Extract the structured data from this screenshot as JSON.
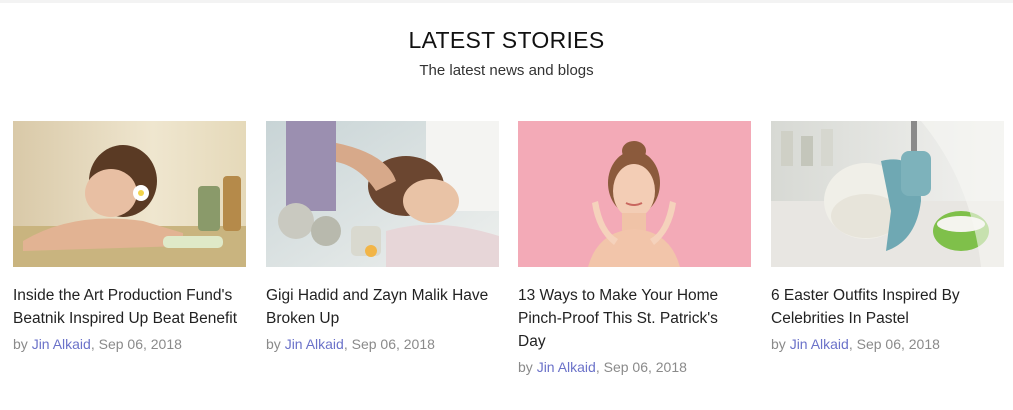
{
  "section": {
    "title": "LATEST STORIES",
    "subtitle": "The latest news and blogs"
  },
  "stories": [
    {
      "title": "Inside the Art Production Fund's Beatnik Inspired Up Beat Benefit",
      "by": "by",
      "author": "Jin Alkaid",
      "date": ", Sep 06, 2018"
    },
    {
      "title": "Gigi Hadid and Zayn Malik Have Broken Up",
      "by": "by",
      "author": "Jin Alkaid",
      "date": ", Sep 06, 2018"
    },
    {
      "title": "13 Ways to Make Your Home Pinch-Proof This St. Patrick's Day",
      "by": "by",
      "author": "Jin Alkaid",
      "date": ", Sep 06, 2018"
    },
    {
      "title": "6 Easter Outfits Inspired By Celebrities In Pastel",
      "by": "by",
      "author": "Jin Alkaid",
      "date": ", Sep 06, 2018"
    }
  ],
  "colors": {
    "author_link": "#6b72c9",
    "meta_text": "#8a8a8a"
  }
}
